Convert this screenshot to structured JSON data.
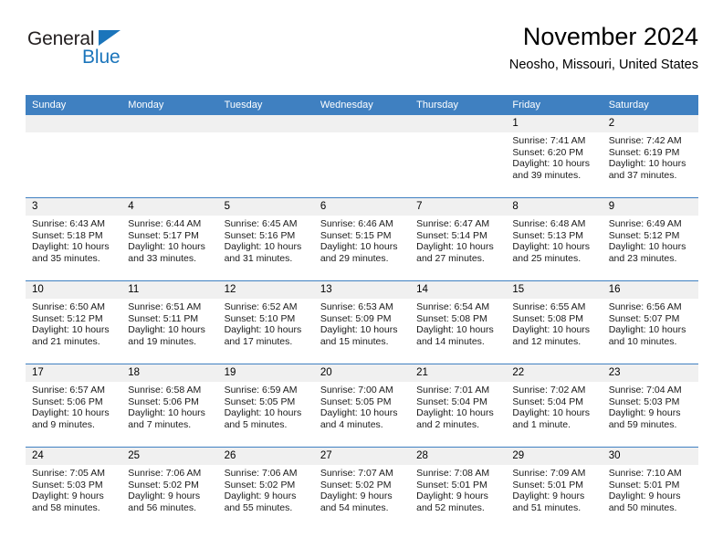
{
  "brand": {
    "name_dark": "General",
    "name_blue": "Blue",
    "accent_color": "#1b75bb"
  },
  "header": {
    "title": "November 2024",
    "subtitle": "Neosho, Missouri, United States",
    "header_bar_color": "#3f80c1",
    "daynum_band_color": "#f0f0f0"
  },
  "weekday_headers": [
    "Sunday",
    "Monday",
    "Tuesday",
    "Wednesday",
    "Thursday",
    "Friday",
    "Saturday"
  ],
  "labels": {
    "sunrise_prefix": "Sunrise:",
    "sunset_prefix": "Sunset:",
    "daylight_prefix": "Daylight:"
  },
  "weeks": [
    [
      {
        "day": "",
        "empty": true
      },
      {
        "day": "",
        "empty": true
      },
      {
        "day": "",
        "empty": true
      },
      {
        "day": "",
        "empty": true
      },
      {
        "day": "",
        "empty": true
      },
      {
        "day": "1",
        "sunrise": "Sunrise: 7:41 AM",
        "sunset": "Sunset: 6:20 PM",
        "daylight": "Daylight: 10 hours and 39 minutes."
      },
      {
        "day": "2",
        "sunrise": "Sunrise: 7:42 AM",
        "sunset": "Sunset: 6:19 PM",
        "daylight": "Daylight: 10 hours and 37 minutes."
      }
    ],
    [
      {
        "day": "3",
        "sunrise": "Sunrise: 6:43 AM",
        "sunset": "Sunset: 5:18 PM",
        "daylight": "Daylight: 10 hours and 35 minutes."
      },
      {
        "day": "4",
        "sunrise": "Sunrise: 6:44 AM",
        "sunset": "Sunset: 5:17 PM",
        "daylight": "Daylight: 10 hours and 33 minutes."
      },
      {
        "day": "5",
        "sunrise": "Sunrise: 6:45 AM",
        "sunset": "Sunset: 5:16 PM",
        "daylight": "Daylight: 10 hours and 31 minutes."
      },
      {
        "day": "6",
        "sunrise": "Sunrise: 6:46 AM",
        "sunset": "Sunset: 5:15 PM",
        "daylight": "Daylight: 10 hours and 29 minutes."
      },
      {
        "day": "7",
        "sunrise": "Sunrise: 6:47 AM",
        "sunset": "Sunset: 5:14 PM",
        "daylight": "Daylight: 10 hours and 27 minutes."
      },
      {
        "day": "8",
        "sunrise": "Sunrise: 6:48 AM",
        "sunset": "Sunset: 5:13 PM",
        "daylight": "Daylight: 10 hours and 25 minutes."
      },
      {
        "day": "9",
        "sunrise": "Sunrise: 6:49 AM",
        "sunset": "Sunset: 5:12 PM",
        "daylight": "Daylight: 10 hours and 23 minutes."
      }
    ],
    [
      {
        "day": "10",
        "sunrise": "Sunrise: 6:50 AM",
        "sunset": "Sunset: 5:12 PM",
        "daylight": "Daylight: 10 hours and 21 minutes."
      },
      {
        "day": "11",
        "sunrise": "Sunrise: 6:51 AM",
        "sunset": "Sunset: 5:11 PM",
        "daylight": "Daylight: 10 hours and 19 minutes."
      },
      {
        "day": "12",
        "sunrise": "Sunrise: 6:52 AM",
        "sunset": "Sunset: 5:10 PM",
        "daylight": "Daylight: 10 hours and 17 minutes."
      },
      {
        "day": "13",
        "sunrise": "Sunrise: 6:53 AM",
        "sunset": "Sunset: 5:09 PM",
        "daylight": "Daylight: 10 hours and 15 minutes."
      },
      {
        "day": "14",
        "sunrise": "Sunrise: 6:54 AM",
        "sunset": "Sunset: 5:08 PM",
        "daylight": "Daylight: 10 hours and 14 minutes."
      },
      {
        "day": "15",
        "sunrise": "Sunrise: 6:55 AM",
        "sunset": "Sunset: 5:08 PM",
        "daylight": "Daylight: 10 hours and 12 minutes."
      },
      {
        "day": "16",
        "sunrise": "Sunrise: 6:56 AM",
        "sunset": "Sunset: 5:07 PM",
        "daylight": "Daylight: 10 hours and 10 minutes."
      }
    ],
    [
      {
        "day": "17",
        "sunrise": "Sunrise: 6:57 AM",
        "sunset": "Sunset: 5:06 PM",
        "daylight": "Daylight: 10 hours and 9 minutes."
      },
      {
        "day": "18",
        "sunrise": "Sunrise: 6:58 AM",
        "sunset": "Sunset: 5:06 PM",
        "daylight": "Daylight: 10 hours and 7 minutes."
      },
      {
        "day": "19",
        "sunrise": "Sunrise: 6:59 AM",
        "sunset": "Sunset: 5:05 PM",
        "daylight": "Daylight: 10 hours and 5 minutes."
      },
      {
        "day": "20",
        "sunrise": "Sunrise: 7:00 AM",
        "sunset": "Sunset: 5:05 PM",
        "daylight": "Daylight: 10 hours and 4 minutes."
      },
      {
        "day": "21",
        "sunrise": "Sunrise: 7:01 AM",
        "sunset": "Sunset: 5:04 PM",
        "daylight": "Daylight: 10 hours and 2 minutes."
      },
      {
        "day": "22",
        "sunrise": "Sunrise: 7:02 AM",
        "sunset": "Sunset: 5:04 PM",
        "daylight": "Daylight: 10 hours and 1 minute."
      },
      {
        "day": "23",
        "sunrise": "Sunrise: 7:04 AM",
        "sunset": "Sunset: 5:03 PM",
        "daylight": "Daylight: 9 hours and 59 minutes."
      }
    ],
    [
      {
        "day": "24",
        "sunrise": "Sunrise: 7:05 AM",
        "sunset": "Sunset: 5:03 PM",
        "daylight": "Daylight: 9 hours and 58 minutes."
      },
      {
        "day": "25",
        "sunrise": "Sunrise: 7:06 AM",
        "sunset": "Sunset: 5:02 PM",
        "daylight": "Daylight: 9 hours and 56 minutes."
      },
      {
        "day": "26",
        "sunrise": "Sunrise: 7:06 AM",
        "sunset": "Sunset: 5:02 PM",
        "daylight": "Daylight: 9 hours and 55 minutes."
      },
      {
        "day": "27",
        "sunrise": "Sunrise: 7:07 AM",
        "sunset": "Sunset: 5:02 PM",
        "daylight": "Daylight: 9 hours and 54 minutes."
      },
      {
        "day": "28",
        "sunrise": "Sunrise: 7:08 AM",
        "sunset": "Sunset: 5:01 PM",
        "daylight": "Daylight: 9 hours and 52 minutes."
      },
      {
        "day": "29",
        "sunrise": "Sunrise: 7:09 AM",
        "sunset": "Sunset: 5:01 PM",
        "daylight": "Daylight: 9 hours and 51 minutes."
      },
      {
        "day": "30",
        "sunrise": "Sunrise: 7:10 AM",
        "sunset": "Sunset: 5:01 PM",
        "daylight": "Daylight: 9 hours and 50 minutes."
      }
    ]
  ]
}
